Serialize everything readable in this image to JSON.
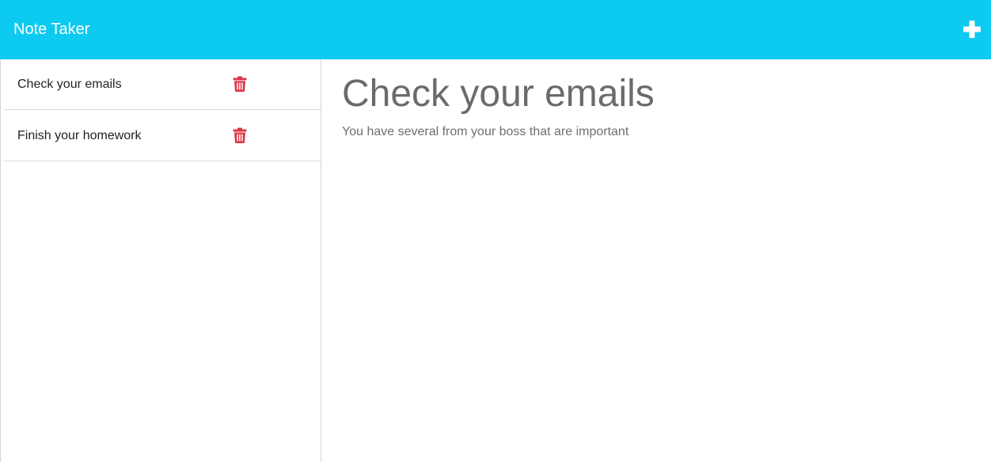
{
  "app": {
    "title": "Note Taker",
    "accent_color": "#0dcaf0",
    "new_note_icon": "plus-icon"
  },
  "notes": [
    {
      "title": "Check your emails",
      "delete_icon": "trash-icon"
    },
    {
      "title": "Finish your homework",
      "delete_icon": "trash-icon"
    }
  ],
  "active_note": {
    "title": "Check your emails",
    "text": "You have several from your boss that are important"
  },
  "colors": {
    "delete_icon": "#dc3545",
    "heading_text": "#6b6b6b"
  }
}
